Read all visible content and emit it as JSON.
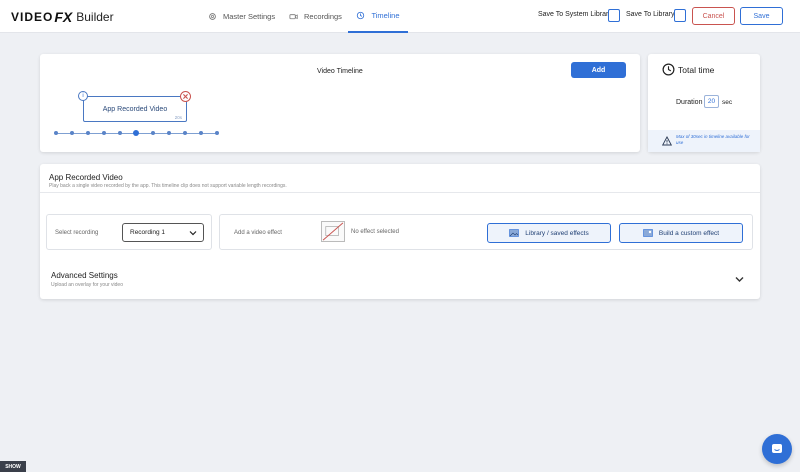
{
  "header": {
    "logo": {
      "part1": "VIDEO",
      "part2": "FX",
      "part3": "Builder"
    },
    "tabs": [
      {
        "label": "Master Settings",
        "icon": "gear-icon"
      },
      {
        "label": "Recordings",
        "icon": "camera-icon"
      },
      {
        "label": "Timeline",
        "icon": "clock-icon",
        "active": true
      }
    ],
    "save_system_label": "Save To System Library",
    "save_library_label": "Save To Library",
    "cancel_label": "Cancel",
    "save_label": "Save"
  },
  "timeline": {
    "title": "Video Timeline",
    "add_label": "Add",
    "clip": {
      "info": "i",
      "label": "App Recorded Video",
      "duration": "20s"
    }
  },
  "total": {
    "title": "Total time",
    "duration_label": "Duration",
    "duration_value": "20",
    "duration_unit": "sec",
    "note": "Max of 30sec in timeline available for use"
  },
  "recorded": {
    "title": "App Recorded Video",
    "subtitle": "Play back a single video recorded by the app. This timeline clip does not support variable length recordings.",
    "select_label": "Select recording",
    "selected": "Recording 1",
    "effect_label": "Add a video effect",
    "no_effect": "No effect selected",
    "library_button": "Library / saved effects",
    "custom_button": "Build a custom effect",
    "advanced_title": "Advanced Settings",
    "advanced_sub": "Upload an overlay for your video"
  },
  "footer": {
    "show_label": "SHOW"
  },
  "colors": {
    "accent": "#2f6fd6",
    "danger": "#c9534f",
    "background": "#eef0f4"
  }
}
